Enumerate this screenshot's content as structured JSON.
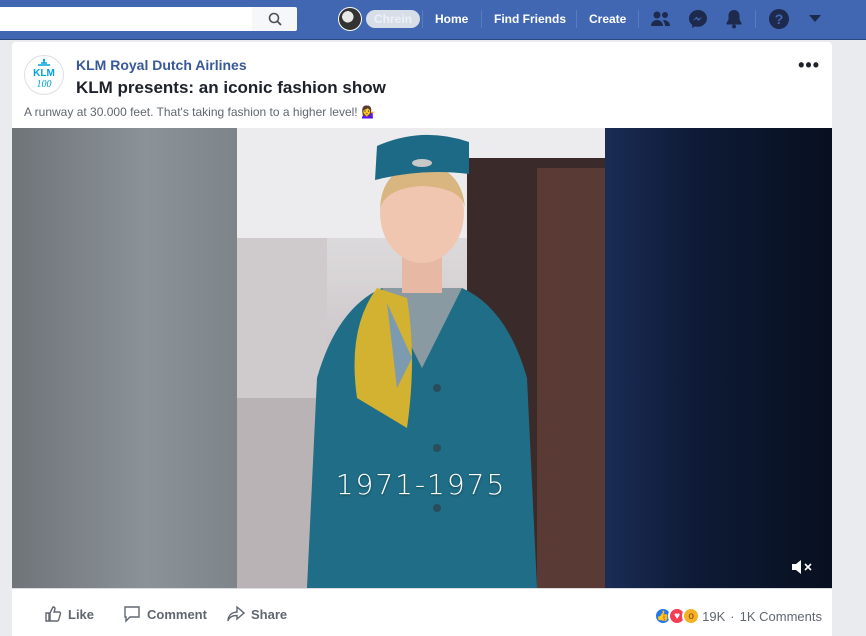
{
  "topbar": {
    "search_placeholder": "",
    "profile_name": "Chrein",
    "nav": [
      "Home",
      "Find Friends",
      "Create"
    ],
    "icons": [
      "friends-icon",
      "messenger-icon",
      "notifications-icon",
      "help-icon",
      "caret-down-icon"
    ]
  },
  "post": {
    "page_name": "KLM Royal Dutch Airlines",
    "logo_text": "KLM",
    "logo_sub": "100",
    "title": "KLM presents: an iconic fashion show",
    "text": "A runway at 30.000 feet. That's taking fashion to a higher level! 💁‍♀️",
    "more": "•••",
    "video_overlay": "1971-1975",
    "actions": {
      "like": "Like",
      "comment": "Comment",
      "share": "Share"
    },
    "reaction_count": "19K",
    "separator": "·",
    "comment_count": "1K Comments"
  },
  "colors": {
    "brand": "#4267b2",
    "link": "#385898"
  }
}
